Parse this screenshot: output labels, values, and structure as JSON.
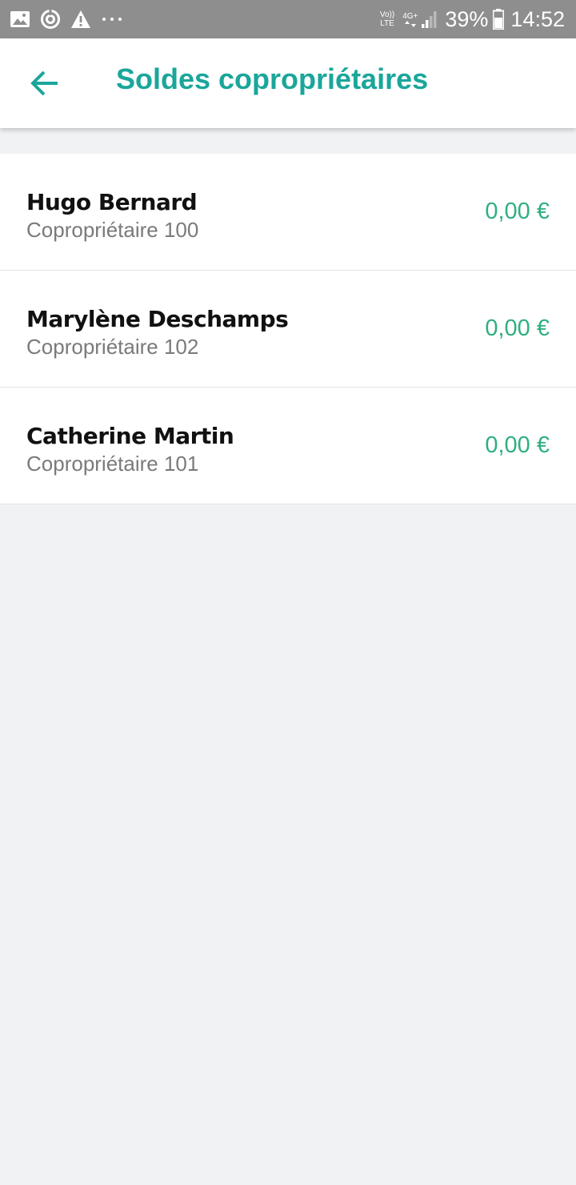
{
  "status_bar": {
    "left_icons": [
      "gallery-icon",
      "sync-icon",
      "warning-icon",
      "more-dots-icon"
    ],
    "volte_top": "Vo))",
    "volte_bottom": "LTE",
    "network_type": "4G+",
    "battery_percent": "39%",
    "time": "14:52"
  },
  "header": {
    "title": "Soldes copropriétaires",
    "back_icon": "arrow-left-icon"
  },
  "owners": [
    {
      "name": "Hugo Bernard",
      "lot": "Copropriétaire 100",
      "balance": "0,00 €"
    },
    {
      "name": "Marylène Deschamps",
      "lot": "Copropriétaire 102",
      "balance": "0,00 €"
    },
    {
      "name": "Catherine Martin",
      "lot": "Copropriétaire 101",
      "balance": "0,00 €"
    }
  ],
  "colors": {
    "accent": "#1aa69b",
    "balance": "#2eb07f",
    "status_bar": "#8e8e8e",
    "background": "#f1f2f4"
  }
}
